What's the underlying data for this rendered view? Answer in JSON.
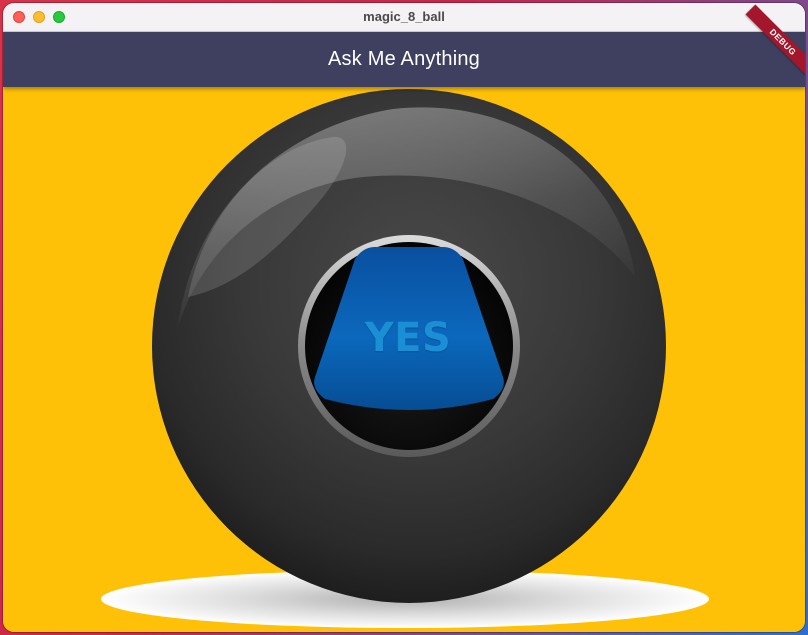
{
  "window": {
    "title": "magic_8_ball",
    "controls": [
      "close",
      "minimize",
      "maximize"
    ]
  },
  "appbar": {
    "title": "Ask Me Anything",
    "background_color": "#3f3f5f"
  },
  "debug_banner": {
    "label": "DEBUG",
    "color": "#a3172d"
  },
  "content": {
    "background_color": "#ffc107",
    "ball_image": {
      "icon": "magic-8-ball",
      "answer": "YES",
      "answer_color": "#1a8fd6",
      "window_color": "#0a5aa8"
    }
  }
}
